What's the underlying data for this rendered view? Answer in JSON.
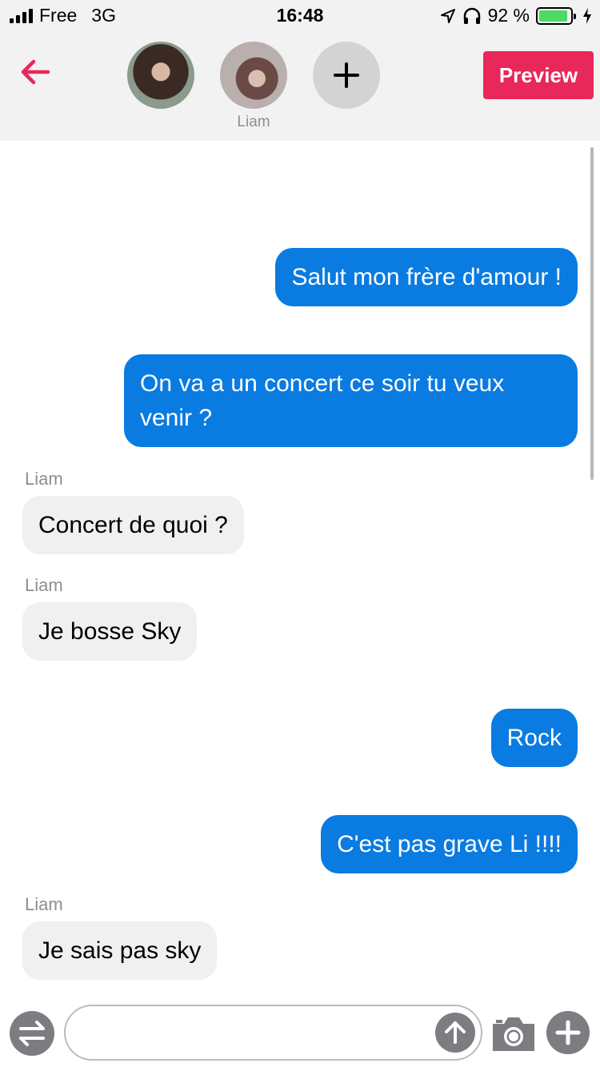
{
  "status_bar": {
    "carrier": "Free",
    "network": "3G",
    "time": "16:48",
    "battery_percent": "92 %",
    "battery_level": 0.92,
    "icons": [
      "signal-icon",
      "location-icon",
      "headphones-icon",
      "battery-icon",
      "charging-icon"
    ]
  },
  "header": {
    "back_icon": "arrow-left-icon",
    "contact_name": "Liam",
    "preview_label": "Preview",
    "add_icon": "plus-icon",
    "colors": {
      "accent": "#e8275a",
      "header_bg": "#f2f2f2"
    }
  },
  "messages": [
    {
      "direction": "outgoing",
      "sender": "",
      "text": "Salut mon frère d'amour !"
    },
    {
      "direction": "outgoing",
      "sender": "",
      "text": "On va a un concert ce soir tu veux venir ?"
    },
    {
      "direction": "incoming",
      "sender": "Liam",
      "text": "Concert de quoi ?"
    },
    {
      "direction": "incoming",
      "sender": "Liam",
      "text": "Je bosse Sky"
    },
    {
      "direction": "outgoing",
      "sender": "",
      "text": "Rock"
    },
    {
      "direction": "outgoing",
      "sender": "",
      "text": "C'est pas grave Li !!!!"
    },
    {
      "direction": "incoming",
      "sender": "Liam",
      "text": "Je sais pas sky"
    }
  ],
  "colors": {
    "outgoing_bubble": "#0a7be0",
    "incoming_bubble": "#f0f0f0",
    "icon_gray": "#7b7d80"
  },
  "composer": {
    "value": "",
    "icons": [
      "swap-arrows-icon",
      "send-arrow-up-icon",
      "camera-icon",
      "plus-circle-icon"
    ]
  }
}
